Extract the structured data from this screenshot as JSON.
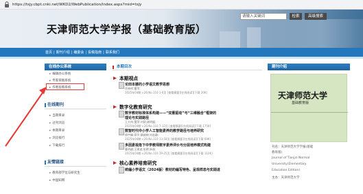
{
  "browser": {
    "url": "https://tsjy.cbpt.cnki.net/WKD2/WebPublication/index.aspx?mid=tsjy"
  },
  "header": {
    "title": "天津师范大学学报（基础教育版）",
    "search_placeholder": "请输入关键词",
    "search_button": "检索",
    "advanced_button": "高级搜索"
  },
  "nav": {
    "items": [
      "首页",
      "期刊介绍",
      "编委会",
      "投稿指南",
      "联系我们"
    ]
  },
  "sidebar": {
    "online_office": {
      "title": "在线办公系统",
      "items": [
        "编辑办公系统",
        "专家审稿系统",
        "作者投稿系统"
      ]
    },
    "online_journal": {
      "title": "在线期刊",
      "items": [
        "当期目录",
        "过刊浏览",
        "本期目录",
        "浏览排行",
        "下载排行"
      ]
    },
    "links": {
      "title": "友情链接",
      "items": [
        "教育部学位与研究生",
        "中国知网"
      ]
    }
  },
  "main": {
    "issue_label": "本期目次",
    "sections": [
      {
        "title": "本期视点",
        "articles": [
          {
            "title": "论田本娜的小学语文教学思想",
            "authors": "徐林祥;曹萍;",
            "meta": "2025年04期 v.26;No.110 1-6页 [查看摘要][在线阅读][下载 20K]"
          }
        ]
      },
      {
        "title": "数字化教育研究",
        "articles": [
          {
            "title": "数字教材标准体系构建——“双重驱动”与“三维融合”框架的",
            "title2": "理论与实践路径",
            "authors": "王大伟;董萍;刘毅;谢明媛;",
            "meta": "2025年04期 v.26;No.110 7-12页 [查看摘要][在线阅读][下载 175K]"
          },
          {
            "title": "数智时代中小学人工智能素养的教学路径与培养研究",
            "authors": "杨宇峰;郑平;康婉婷;刘若静;",
            "meta": "2025年04期 v.26;No.110 13-18页 [查看摘要][在线阅读][下载 69K]"
          },
          {
            "title": "多因素视角下中学教师数字素养评价与分层培养模式构建",
            "authors": "曹明越;王建波;张艳;朱珠;",
            "meta": "2025年04期 v.26;No.110 19-25页 [查看摘要][在线阅读][下载 112K]"
          }
        ]
      },
      {
        "title": "核心素养培育研究",
        "articles": [
          {
            "title": "统编小学语文（2024版）教材的编写特色、呈现样态与实践进",
            "authors": "",
            "meta": ""
          }
        ]
      }
    ]
  },
  "right": {
    "title": "期刊介绍",
    "cover_title": "天津师范大学",
    "cover_sub": "基础教育版",
    "lines": [
      "刊名：天津师范大学学报(基础",
      "教育版)",
      "Journal of Tianjin Normal",
      "University(Elementary",
      "Education Edition)",
      "主办：天津师范大学"
    ]
  },
  "colors": {
    "nav": "#2377bd",
    "highlight": "#e53935",
    "section_icon": "#c62828"
  }
}
